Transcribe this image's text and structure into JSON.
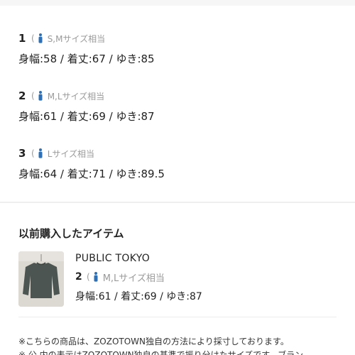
{
  "sizes": [
    {
      "num": "1",
      "size": "S,Mサイズ相当",
      "measure": "身幅:58 / 着丈:67 / ゆき:85"
    },
    {
      "num": "2",
      "size": "M,Lサイズ相当",
      "measure": "身幅:61 / 着丈:69 / ゆき:87"
    },
    {
      "num": "3",
      "size": "Lサイズ相当",
      "measure": "身幅:64 / 着丈:71 / ゆき:89.5"
    }
  ],
  "paren_open": "(",
  "icons": {
    "size_icon": "person-icon",
    "size_icon_color": "#2f6fb3"
  },
  "previous": {
    "title": "以前購入したアイテム",
    "brand": "PUBLIC TOKYO",
    "num": "2",
    "size": "M,Lサイズ相当",
    "measure": "身幅:61 / 着丈:69 / ゆき:87"
  },
  "notes": [
    "※こちらの商品は、ZOZOTOWN独自の方法により採寸しております。",
    "※ 公 内の表示はZOZOTOWN独自の基準で振り分けたサイズです。ブラン"
  ]
}
